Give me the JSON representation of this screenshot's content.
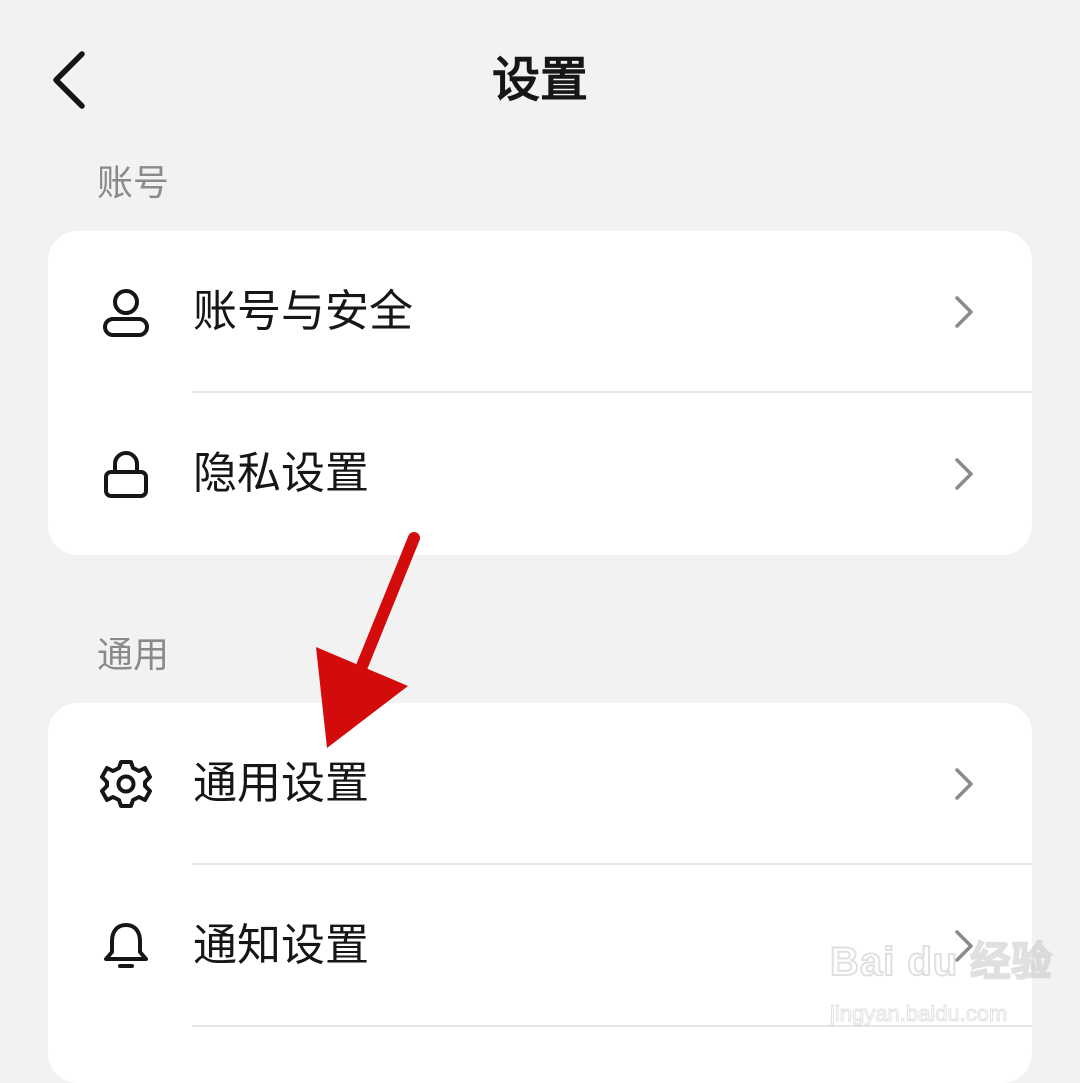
{
  "header": {
    "title": "设置",
    "back_icon": "chevron-left-icon"
  },
  "sections": [
    {
      "title": "账号",
      "items": [
        {
          "label": "账号与安全",
          "icon": "user-icon"
        },
        {
          "label": "隐私设置",
          "icon": "lock-icon"
        }
      ]
    },
    {
      "title": "通用",
      "items": [
        {
          "label": "通用设置",
          "icon": "gear-icon"
        },
        {
          "label": "通知设置",
          "icon": "bell-icon"
        }
      ]
    }
  ],
  "annotation": {
    "arrow_color": "#d40b0b"
  },
  "watermark": {
    "logo_text": "Bai du 经验",
    "url": "jingyan.baidu.com"
  }
}
